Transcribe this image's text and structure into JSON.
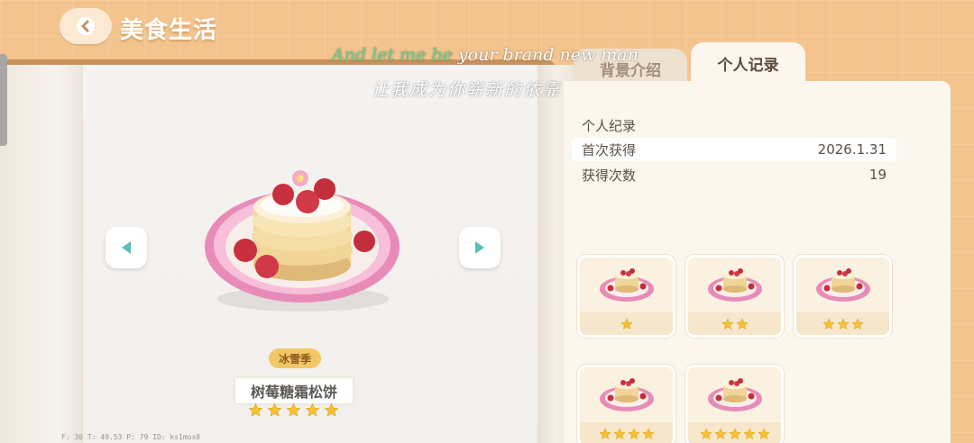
{
  "header": {
    "title": "美食生活"
  },
  "tabs": [
    {
      "label": "背景介绍",
      "active": false
    },
    {
      "label": "个人记录",
      "active": true
    }
  ],
  "record": {
    "title": "个人纪录",
    "rows": [
      {
        "label": "首次获得",
        "value": "2026.1.31"
      },
      {
        "label": "获得次数",
        "value": "19"
      }
    ]
  },
  "food": {
    "season": "冰雪季",
    "name": "树莓糖霜松饼",
    "stars": 5
  },
  "variants": [
    {
      "stars": 1
    },
    {
      "stars": 2
    },
    {
      "stars": 3
    },
    {
      "stars": 4
    },
    {
      "stars": 5
    }
  ],
  "debug": "F: 30   T: 49.53   P: 79   ID: ks1mox8",
  "lyrics": {
    "en_sung": "And let me be",
    "en_rest": " your brand new man",
    "zh": "让我成为你崭新的依靠"
  },
  "colors": {
    "background": "#f4c48f",
    "star": "#f6c233",
    "accent": "#5bc0b5"
  }
}
